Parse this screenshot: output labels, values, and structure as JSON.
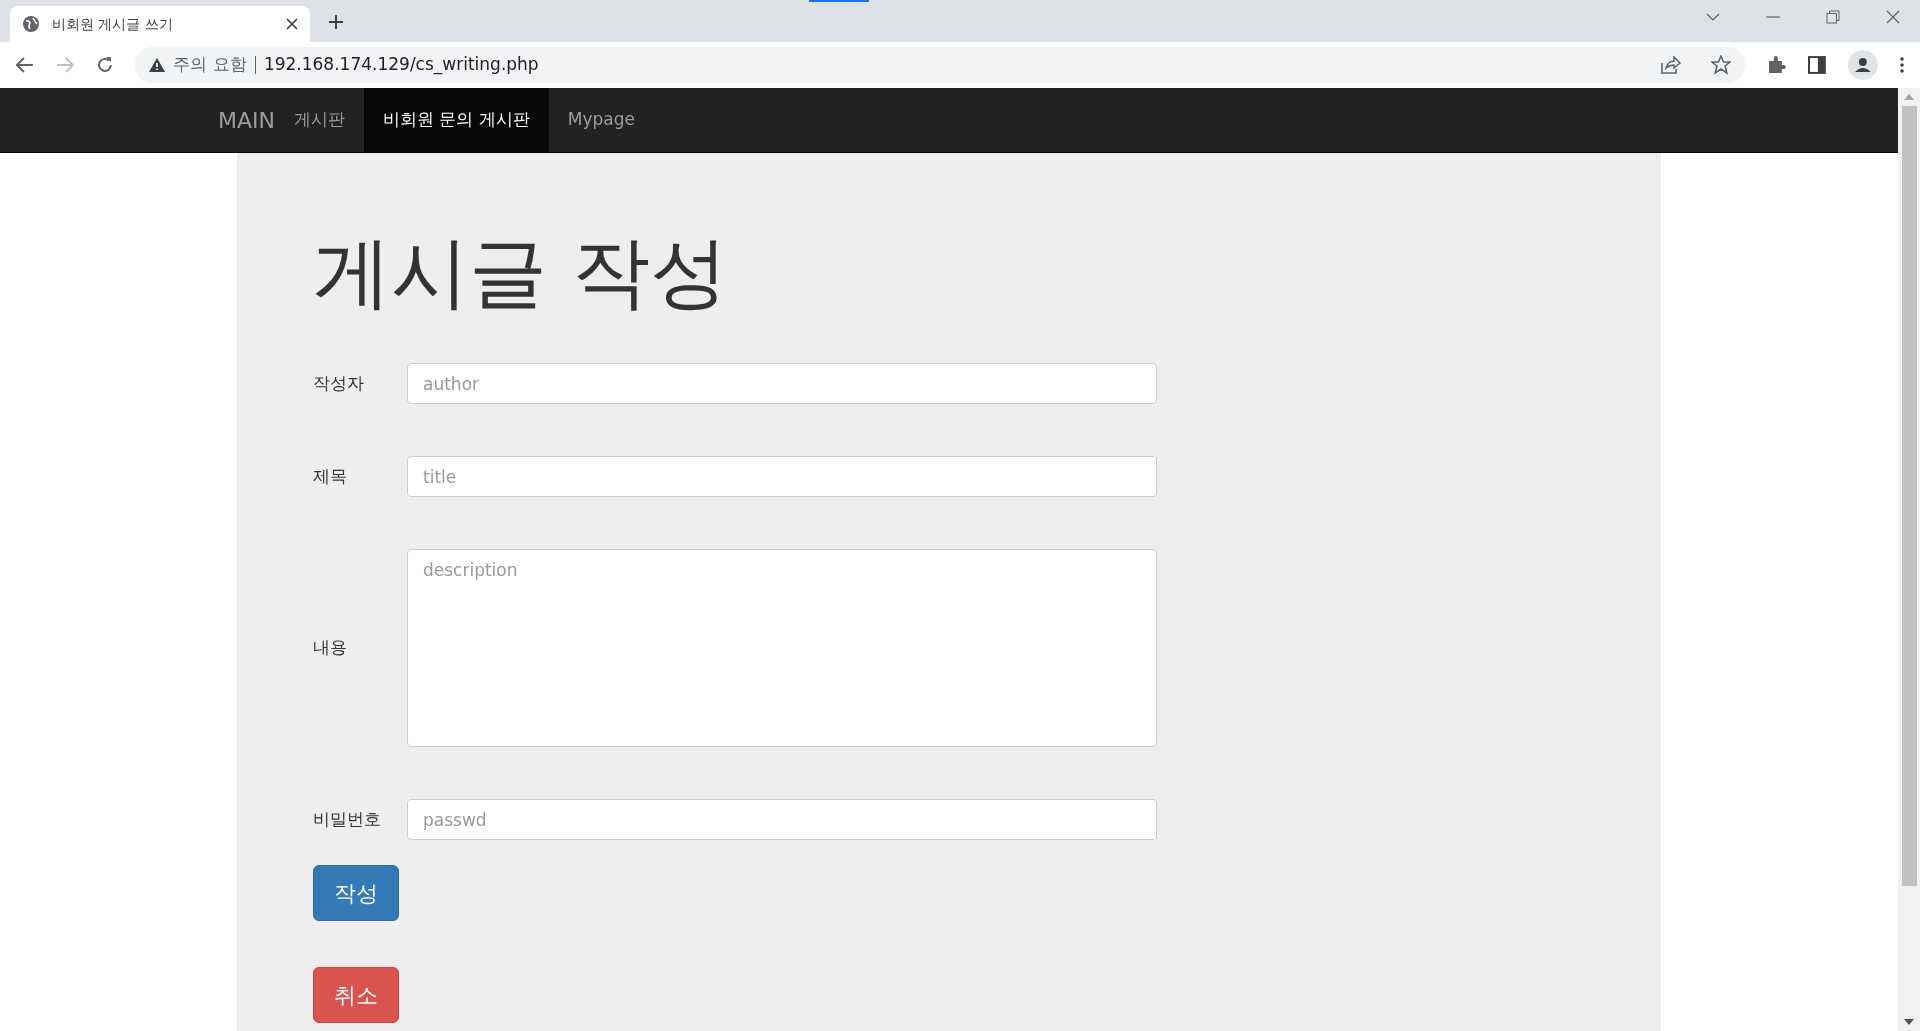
{
  "browser": {
    "tab_title": "비회원 게시글 쓰기",
    "security_label": "주의 요함",
    "url": "192.168.174.129/cs_writing.php"
  },
  "navbar": {
    "brand": "MAIN",
    "items": [
      {
        "label": "게시판",
        "selected": false
      },
      {
        "label": "비회원 문의 게시판",
        "selected": true
      },
      {
        "label": "Mypage",
        "selected": false
      }
    ]
  },
  "heading": "게시글 작성",
  "form": {
    "fields": [
      {
        "label": "작성자",
        "kind": "input",
        "placeholder": "author"
      },
      {
        "label": "제목",
        "kind": "input",
        "placeholder": "title"
      },
      {
        "label": "내용",
        "kind": "textarea",
        "placeholder": "description"
      },
      {
        "label": "비밀번호",
        "kind": "input",
        "placeholder": "passwd"
      }
    ],
    "buttons": [
      {
        "label": "작성",
        "kind": "primary"
      },
      {
        "label": "취소",
        "kind": "danger"
      }
    ]
  }
}
